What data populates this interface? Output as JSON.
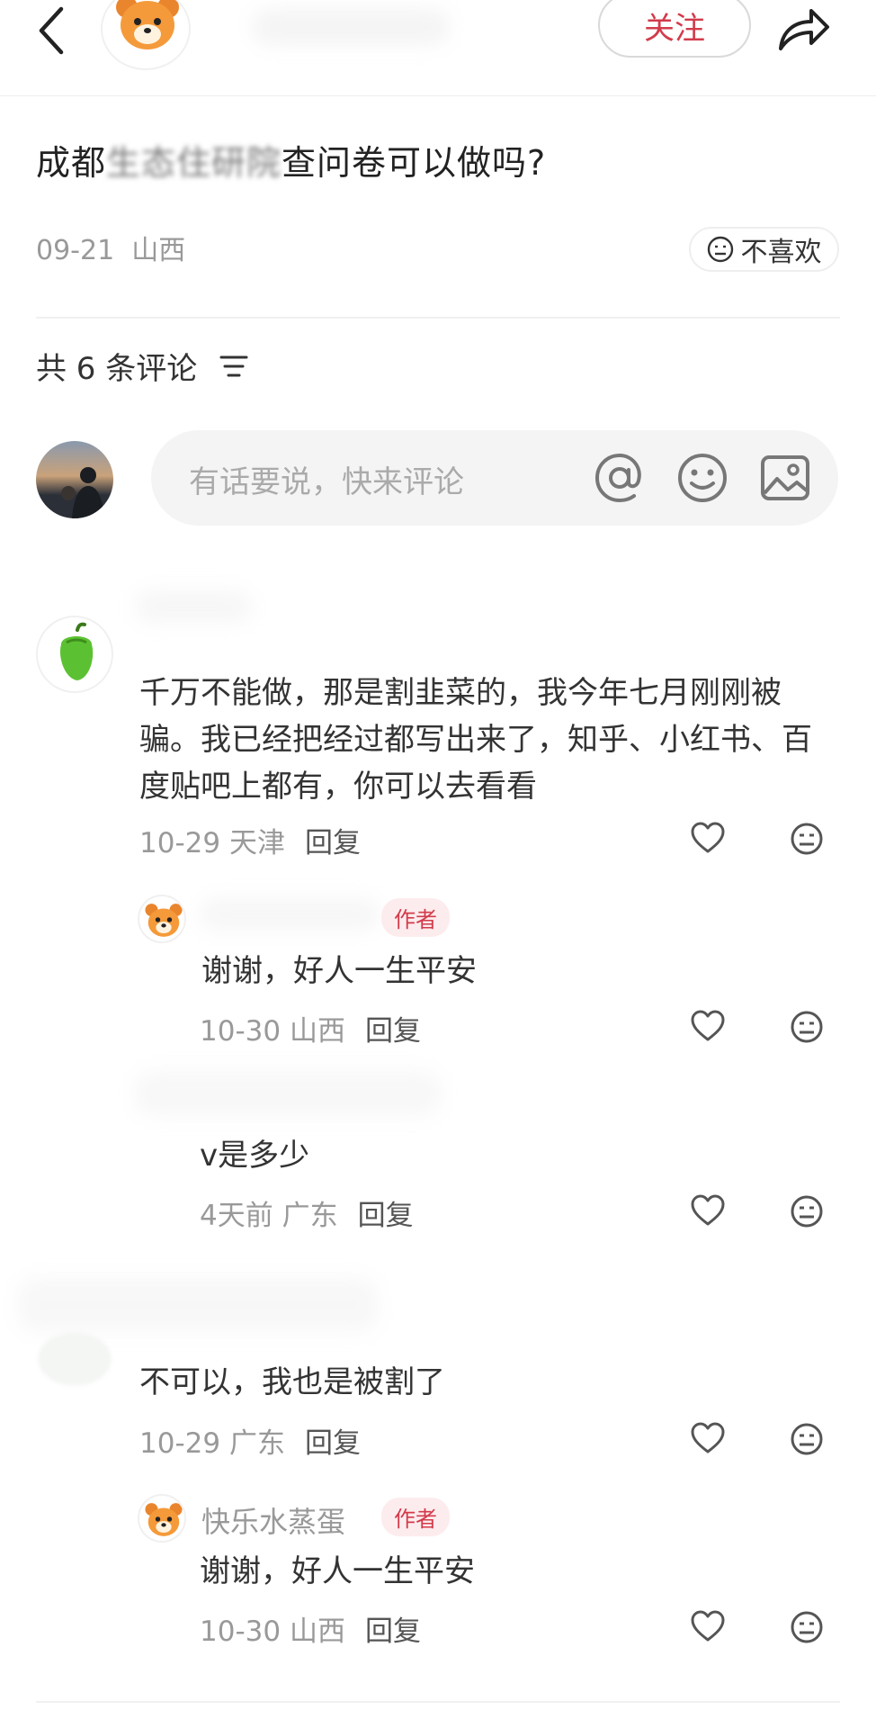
{
  "header": {
    "follow_label": "关注"
  },
  "post": {
    "title_part1": "成都",
    "title_blurred": "生态住研院",
    "title_part2": "查问卷可以做吗?",
    "date": "09-21",
    "location": "山西",
    "dislike_label": "不喜欢"
  },
  "comments_section": {
    "count_label": "共 6 条评论",
    "input_placeholder": "有话要说，快来评论"
  },
  "comments": [
    {
      "text": "千万不能做，那是割韭菜的，我今年七月刚刚被骗。我已经把经过都写出来了，知乎、小红书、百度贴吧上都有，你可以去看看",
      "date": "10-29",
      "location": "天津",
      "reply_label": "回复",
      "replies": [
        {
          "author_tag": "作者",
          "text": "谢谢，好人一生平安",
          "date": "10-30",
          "location": "山西",
          "reply_label": "回复"
        },
        {
          "text": "v是多少",
          "date": "4天前",
          "location": "广东",
          "reply_label": "回复"
        }
      ]
    },
    {
      "text": "不可以，我也是被割了",
      "date": "10-29",
      "location": "广东",
      "reply_label": "回复",
      "replies": [
        {
          "name": "快乐水蒸蛋",
          "author_tag": "作者",
          "text": "谢谢，好人一生平安",
          "date": "10-30",
          "location": "山西",
          "reply_label": "回复"
        }
      ]
    }
  ]
}
